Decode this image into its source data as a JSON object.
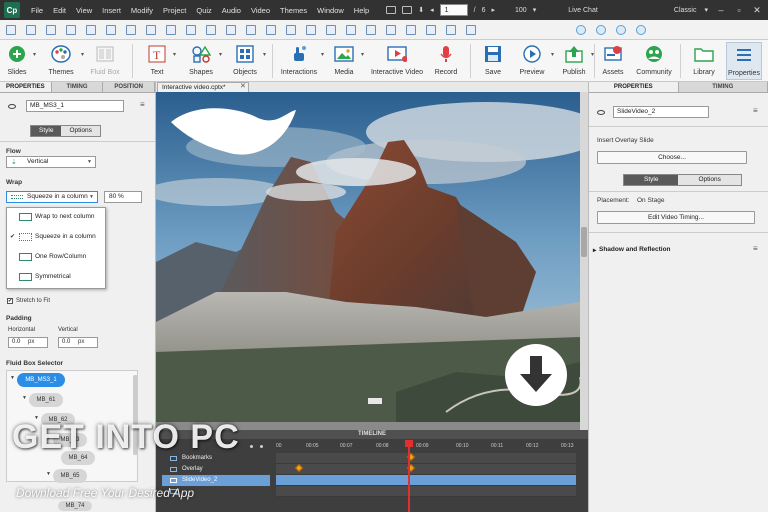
{
  "app": {
    "logo_text": "Cp",
    "menu": [
      "File",
      "Edit",
      "View",
      "Insert",
      "Modify",
      "Project",
      "Quiz",
      "Audio",
      "Video",
      "Themes",
      "Window",
      "Help"
    ],
    "page_current": "1",
    "page_separator": "/",
    "page_total": "6",
    "zoom": "100",
    "live_chat": "Live Chat",
    "workspace": "Classic",
    "window_buttons": [
      "–",
      "▫",
      "✕"
    ]
  },
  "toolbar": {
    "slides": "Slides",
    "themes": "Themes",
    "fluid_box": "Fluid Box",
    "text": "Text",
    "shapes": "Shapes",
    "objects": "Objects",
    "interactions": "Interactions",
    "media": "Media",
    "interactive_video": "Interactive Video",
    "record": "Record",
    "save": "Save",
    "preview": "Preview",
    "publish": "Publish",
    "assets": "Assets",
    "community": "Community",
    "library": "Library",
    "properties": "Properties"
  },
  "left_panel": {
    "tabs": [
      "PROPERTIES",
      "TIMING",
      "POSITION"
    ],
    "object_name": "MB_MS3_1",
    "style_toggle": [
      "Style",
      "Options"
    ],
    "flow_label": "Flow",
    "flow_value": "Vertical",
    "wrap_label": "Wrap",
    "wrap_value": "Squeeze in a column",
    "wrap_percent": "80 %",
    "wrap_options": [
      "Wrap to next column",
      "Squeeze in a column",
      "One Row/Column",
      "Symmetrical"
    ],
    "stretch_label": "Stretch to Fit",
    "padding_label": "Padding",
    "horizontal_label": "Horizontal",
    "vertical_label": "Vertical",
    "padding_h": "0.0",
    "padding_v": "0.0",
    "unit": "px",
    "selector_label": "Fluid Box Selector",
    "selector_items": [
      "MB_MS3_1",
      "MB_61",
      "MB_62",
      "MB_63",
      "MB_64",
      "MB_65",
      "MB_74"
    ]
  },
  "document": {
    "tab_title": "Interactive video.cptx*"
  },
  "timeline": {
    "title": "TIMELINE",
    "ruler": [
      "00",
      "00:05",
      "00:07",
      "00:08",
      "00:09",
      "00:10",
      "00:11",
      "00:12",
      "00:13"
    ],
    "rows": [
      "Bookmarks",
      "Overlay",
      "SlideVideo_2",
      ""
    ]
  },
  "right_panel": {
    "tabs": [
      "PROPERTIES",
      "TIMING"
    ],
    "object_name": "SlideVideo_2",
    "insert_overlay_label": "Insert Overlay Slide",
    "choose_button": "Choose...",
    "style_toggle": [
      "Style",
      "Options"
    ],
    "placement_label": "Placement:",
    "placement_value": "On Stage",
    "edit_timing_button": "Edit Video Timing...",
    "shadow_section": "Shadow and Reflection"
  },
  "watermark": {
    "main": "GET INTO PC",
    "sub": "Download Free Your Desired App"
  },
  "colors": {
    "menubar": "#323232",
    "accent_blue": "#2a8ee8",
    "selected_track": "#6a9fd8",
    "playhead": "#e03030",
    "keyframe": "#f0a020"
  }
}
